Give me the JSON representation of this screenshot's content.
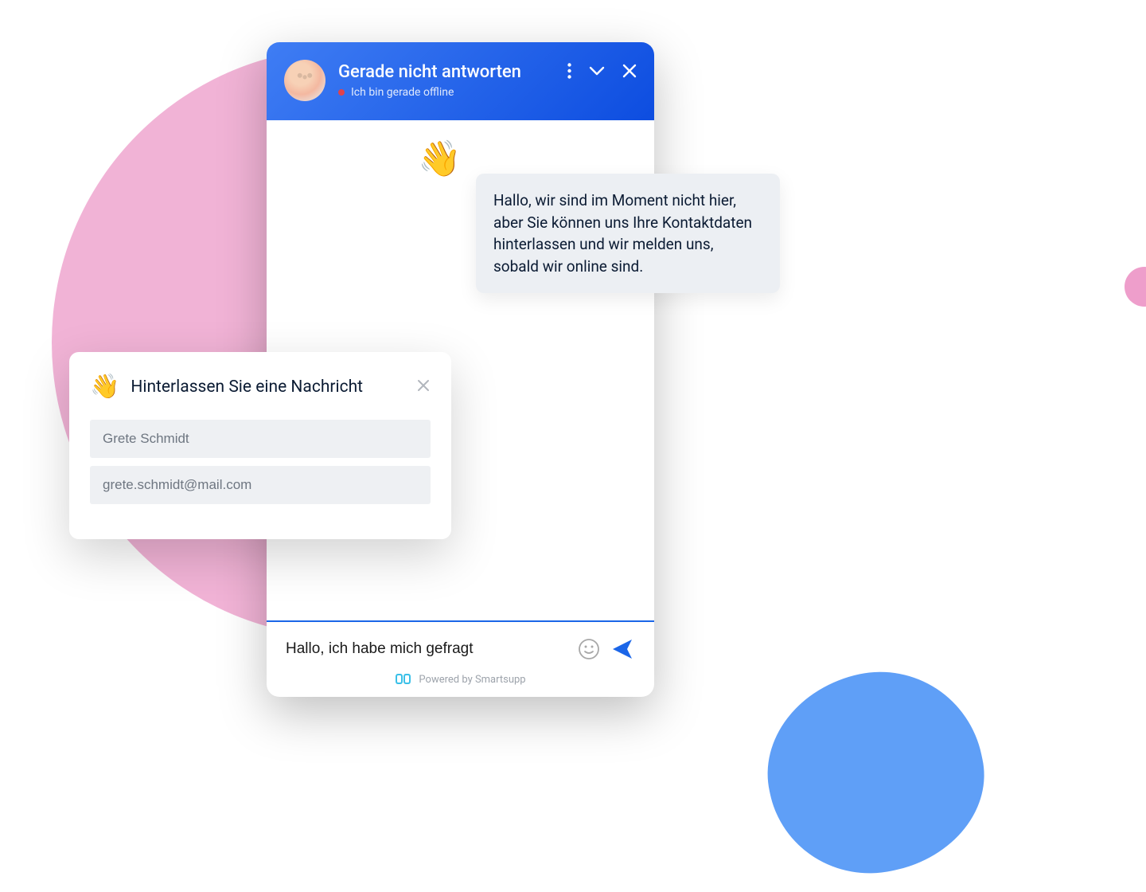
{
  "header": {
    "title": "Gerade nicht antworten",
    "status_text": "Ich bin gerade offline"
  },
  "messages": {
    "offline_notice": "Hallo, wir sind im Moment nicht hier, aber Sie können uns Ihre Kontaktdaten hinterlassen und wir melden uns, sobald wir online sind."
  },
  "input": {
    "draft_text": "Hallo, ich habe mich gefragt"
  },
  "footer": {
    "powered_by": "Powered by Smartsupp"
  },
  "leave_message": {
    "title": "Hinterlassen Sie eine Nachricht",
    "name_value": "Grete Schmidt",
    "email_value": "grete.schmidt@mail.com"
  },
  "icons": {
    "wave": "👋"
  }
}
